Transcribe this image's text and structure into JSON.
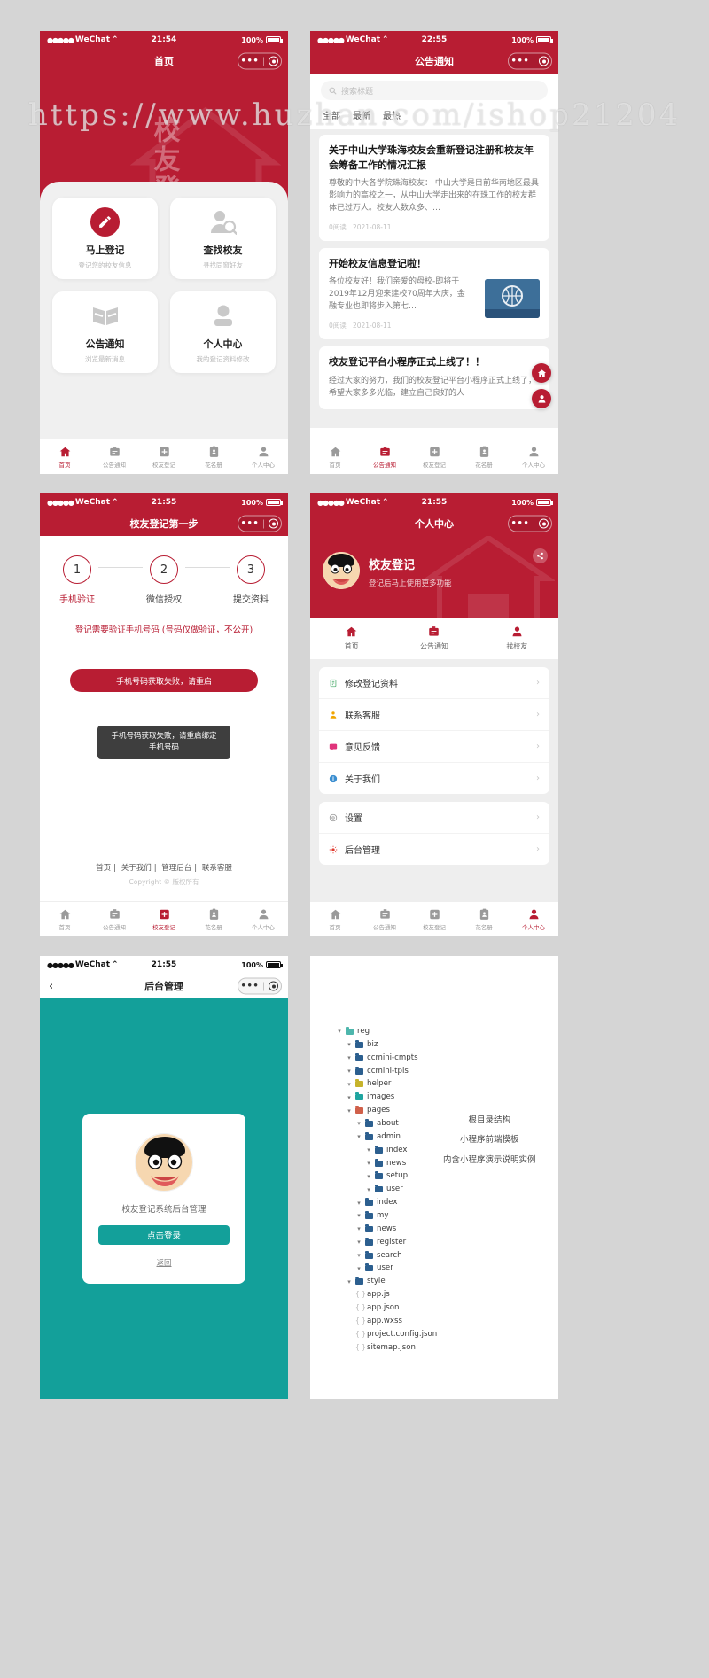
{
  "watermark": {
    "text": "https://www.huzhan.com/ishop21204"
  },
  "phone_home": {
    "status": {
      "carrier": "WeChat",
      "time": "21:54",
      "battery": "100%"
    },
    "title": "首页",
    "hero_title": "校友登记",
    "cards": [
      {
        "icon": "pencil-icon",
        "title": "马上登记",
        "sub": "登记您的校友信息"
      },
      {
        "icon": "user-search-icon",
        "title": "查找校友",
        "sub": "寻找同窗好友"
      },
      {
        "icon": "book-icon",
        "title": "公告通知",
        "sub": "浏览最新消息"
      },
      {
        "icon": "person-icon",
        "title": "个人中心",
        "sub": "我的登记资料修改"
      }
    ],
    "tabs": [
      {
        "icon": "home-icon",
        "label": "首页",
        "active": true
      },
      {
        "icon": "notice-icon",
        "label": "公告通知",
        "active": false
      },
      {
        "icon": "plus-icon",
        "label": "校友登记",
        "active": false
      },
      {
        "icon": "card-icon",
        "label": "花名册",
        "active": false
      },
      {
        "icon": "person-icon",
        "label": "个人中心",
        "active": false
      }
    ]
  },
  "phone_notice": {
    "status": {
      "carrier": "WeChat",
      "time": "22:55",
      "battery": "100%"
    },
    "title": "公告通知",
    "search": {
      "placeholder": "搜索标题",
      "icon": "search-icon"
    },
    "filters": [
      "全部",
      "最新",
      "最热"
    ],
    "news": [
      {
        "title": "关于中山大学珠海校友会重新登记注册和校友年会筹备工作的情况汇报",
        "summary": "尊敬的中大各学院珠海校友：  中山大学是目前华南地区最具影响力的高校之一，从中山大学走出来的在珠工作的校友群体已过万人。校友人数众多、…",
        "reads": "0阅读",
        "date": "2021-08-11",
        "has_thumb": false
      },
      {
        "title": "开始校友信息登记啦！",
        "summary": "各位校友好！我们亲爱的母校-即将于2019年12月迎来建校70周年大庆，金融专业也即将步入第七…",
        "reads": "0阅读",
        "date": "2021-08-11",
        "has_thumb": true
      },
      {
        "title": "校友登记平台小程序正式上线了！！",
        "summary": "经过大家的努力，我们的校友登记平台小程序正式上线了，希望大家多多光临，建立自己良好的人",
        "reads": "",
        "date": "",
        "has_thumb": false
      }
    ],
    "fabs": [
      {
        "icon": "home-icon",
        "name": "fab-home"
      },
      {
        "icon": "person-icon",
        "name": "fab-profile"
      }
    ],
    "tabs": [
      {
        "icon": "home-icon",
        "label": "首页",
        "active": false
      },
      {
        "icon": "notice-icon",
        "label": "公告通知",
        "active": true
      },
      {
        "icon": "plus-icon",
        "label": "校友登记",
        "active": false
      },
      {
        "icon": "card-icon",
        "label": "花名册",
        "active": false
      },
      {
        "icon": "person-icon",
        "label": "个人中心",
        "active": false
      }
    ]
  },
  "phone_step": {
    "status": {
      "carrier": "WeChat",
      "time": "21:55",
      "battery": "100%"
    },
    "title": "校友登记第一步",
    "steps": [
      {
        "num": "1",
        "label": "手机验证",
        "active": true
      },
      {
        "num": "2",
        "label": "微信授权",
        "active": false
      },
      {
        "num": "3",
        "label": "提交资料",
        "active": false
      }
    ],
    "hint": "登记需要验证手机号码 (号码仅做验证，不公开)",
    "button_label": "手机号码获取失败，请重启",
    "toast": "手机号码获取失败，请重启绑定手机号码",
    "footer_links": [
      "首页",
      "关于我们",
      "管理后台",
      "联系客服"
    ],
    "copyright": "Copyright © 版权所有",
    "tabs": [
      {
        "icon": "home-icon",
        "label": "首页",
        "active": false
      },
      {
        "icon": "notice-icon",
        "label": "公告通知",
        "active": false
      },
      {
        "icon": "plus-icon",
        "label": "校友登记",
        "active": true
      },
      {
        "icon": "card-icon",
        "label": "花名册",
        "active": false
      },
      {
        "icon": "person-icon",
        "label": "个人中心",
        "active": false
      }
    ]
  },
  "phone_profile": {
    "status": {
      "carrier": "WeChat",
      "time": "21:55",
      "battery": "100%"
    },
    "title": "个人中心",
    "user": {
      "name": "校友登记",
      "desc": "登记后马上使用更多功能",
      "avatar": "avatar"
    },
    "share_icon": "share-icon",
    "quick": [
      {
        "icon": "home-icon",
        "label": "首页"
      },
      {
        "icon": "notice-icon",
        "label": "公告通知"
      },
      {
        "icon": "person-icon",
        "label": "找校友"
      }
    ],
    "menu_group_1": [
      {
        "icon": "doc-icon",
        "label": "修改登记资料"
      },
      {
        "icon": "service-icon",
        "label": "联系客服"
      },
      {
        "icon": "feedback-icon",
        "label": "意见反馈"
      },
      {
        "icon": "info-icon",
        "label": "关于我们"
      }
    ],
    "menu_group_2": [
      {
        "icon": "gear-icon",
        "label": "设置"
      },
      {
        "icon": "admin-icon",
        "label": "后台管理"
      }
    ],
    "tabs": [
      {
        "icon": "home-icon",
        "label": "首页",
        "active": false
      },
      {
        "icon": "notice-icon",
        "label": "公告通知",
        "active": false
      },
      {
        "icon": "plus-icon",
        "label": "校友登记",
        "active": false
      },
      {
        "icon": "card-icon",
        "label": "花名册",
        "active": false
      },
      {
        "icon": "person-icon",
        "label": "个人中心",
        "active": true
      }
    ]
  },
  "phone_login": {
    "status": {
      "carrier": "WeChat",
      "time": "21:55",
      "battery": "100%"
    },
    "title": "后台管理",
    "back_icon": "chevron-left-icon",
    "card_title": "校友登记系统后台管理",
    "login_button": "点击登录",
    "back_link": "返回"
  },
  "tree_panel": {
    "note_lines": [
      "根目录结构",
      "小程序前端模板",
      "内含小程序演示说明实例"
    ],
    "nodes": [
      {
        "depth": 0,
        "label": "reg",
        "type": "folder",
        "color": "#4db6ac",
        "caret": true
      },
      {
        "depth": 1,
        "label": "biz",
        "type": "folder",
        "color": "#2c5f8f",
        "caret": true
      },
      {
        "depth": 1,
        "label": "ccmini-cmpts",
        "type": "folder",
        "color": "#2c5f8f",
        "caret": true
      },
      {
        "depth": 1,
        "label": "ccmini-tpls",
        "type": "folder",
        "color": "#2c5f8f",
        "caret": true
      },
      {
        "depth": 1,
        "label": "helper",
        "type": "folder",
        "color": "#c6b32b",
        "caret": true
      },
      {
        "depth": 1,
        "label": "images",
        "type": "folder",
        "color": "#1fa5a0",
        "caret": true
      },
      {
        "depth": 1,
        "label": "pages",
        "type": "folder",
        "color": "#d0604a",
        "caret": true
      },
      {
        "depth": 2,
        "label": "about",
        "type": "folder",
        "color": "#2c5f8f",
        "caret": true
      },
      {
        "depth": 2,
        "label": "admin",
        "type": "folder",
        "color": "#2c5f8f",
        "caret": true
      },
      {
        "depth": 3,
        "label": "index",
        "type": "folder",
        "color": "#2c5f8f",
        "caret": true
      },
      {
        "depth": 3,
        "label": "news",
        "type": "folder",
        "color": "#2c5f8f",
        "caret": true
      },
      {
        "depth": 3,
        "label": "setup",
        "type": "folder",
        "color": "#2c5f8f",
        "caret": true
      },
      {
        "depth": 3,
        "label": "user",
        "type": "folder",
        "color": "#2c5f8f",
        "caret": true
      },
      {
        "depth": 2,
        "label": "index",
        "type": "folder",
        "color": "#2c5f8f",
        "caret": true
      },
      {
        "depth": 2,
        "label": "my",
        "type": "folder",
        "color": "#2c5f8f",
        "caret": true
      },
      {
        "depth": 2,
        "label": "news",
        "type": "folder",
        "color": "#2c5f8f",
        "caret": true
      },
      {
        "depth": 2,
        "label": "register",
        "type": "folder",
        "color": "#2c5f8f",
        "caret": true
      },
      {
        "depth": 2,
        "label": "search",
        "type": "folder",
        "color": "#2c5f8f",
        "caret": true
      },
      {
        "depth": 2,
        "label": "user",
        "type": "folder",
        "color": "#2c5f8f",
        "caret": true
      },
      {
        "depth": 1,
        "label": "style",
        "type": "folder",
        "color": "#2c5f8f",
        "caret": true
      },
      {
        "depth": 1,
        "label": "app.js",
        "type": "file",
        "icon": "js",
        "caret": false
      },
      {
        "depth": 1,
        "label": "app.json",
        "type": "file",
        "icon": "json",
        "caret": false
      },
      {
        "depth": 1,
        "label": "app.wxss",
        "type": "file",
        "icon": "wxss",
        "caret": false
      },
      {
        "depth": 1,
        "label": "project.config.json",
        "type": "file",
        "icon": "json",
        "caret": false
      },
      {
        "depth": 1,
        "label": "sitemap.json",
        "type": "file",
        "icon": "json",
        "caret": false
      }
    ]
  }
}
